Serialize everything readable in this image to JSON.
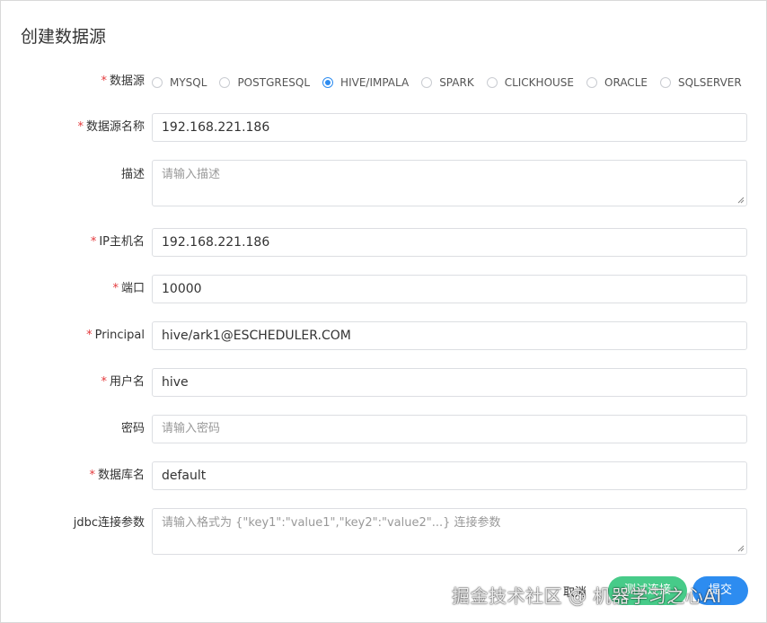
{
  "dialog": {
    "title": "创建数据源"
  },
  "fields": {
    "type": {
      "label": "数据源",
      "options": [
        "MYSQL",
        "POSTGRESQL",
        "HIVE/IMPALA",
        "SPARK",
        "CLICKHOUSE",
        "ORACLE",
        "SQLSERVER"
      ],
      "selected": "HIVE/IMPALA"
    },
    "name": {
      "label": "数据源名称",
      "value": "192.168.221.186"
    },
    "description": {
      "label": "描述",
      "placeholder": "请输入描述"
    },
    "host": {
      "label": "IP主机名",
      "value": "192.168.221.186"
    },
    "port": {
      "label": "端口",
      "value": "10000"
    },
    "principal": {
      "label": "Principal",
      "value": "hive/ark1@ESCHEDULER.COM"
    },
    "username": {
      "label": "用户名",
      "value": "hive"
    },
    "password": {
      "label": "密码",
      "placeholder": "请输入密码"
    },
    "database": {
      "label": "数据库名",
      "value": "default"
    },
    "jdbc": {
      "label": "jdbc连接参数",
      "placeholder": "请输入格式为 {\"key1\":\"value1\",\"key2\":\"value2\"...} 连接参数"
    }
  },
  "footer": {
    "cancel": "取消",
    "test": "测试连接",
    "submit": "提交"
  },
  "watermark": "掘金技术社区 @ 机器学习之心AI",
  "colors": {
    "accent": "#2d8cf0",
    "test_button": "#47cb89",
    "required": "#e4393c"
  }
}
